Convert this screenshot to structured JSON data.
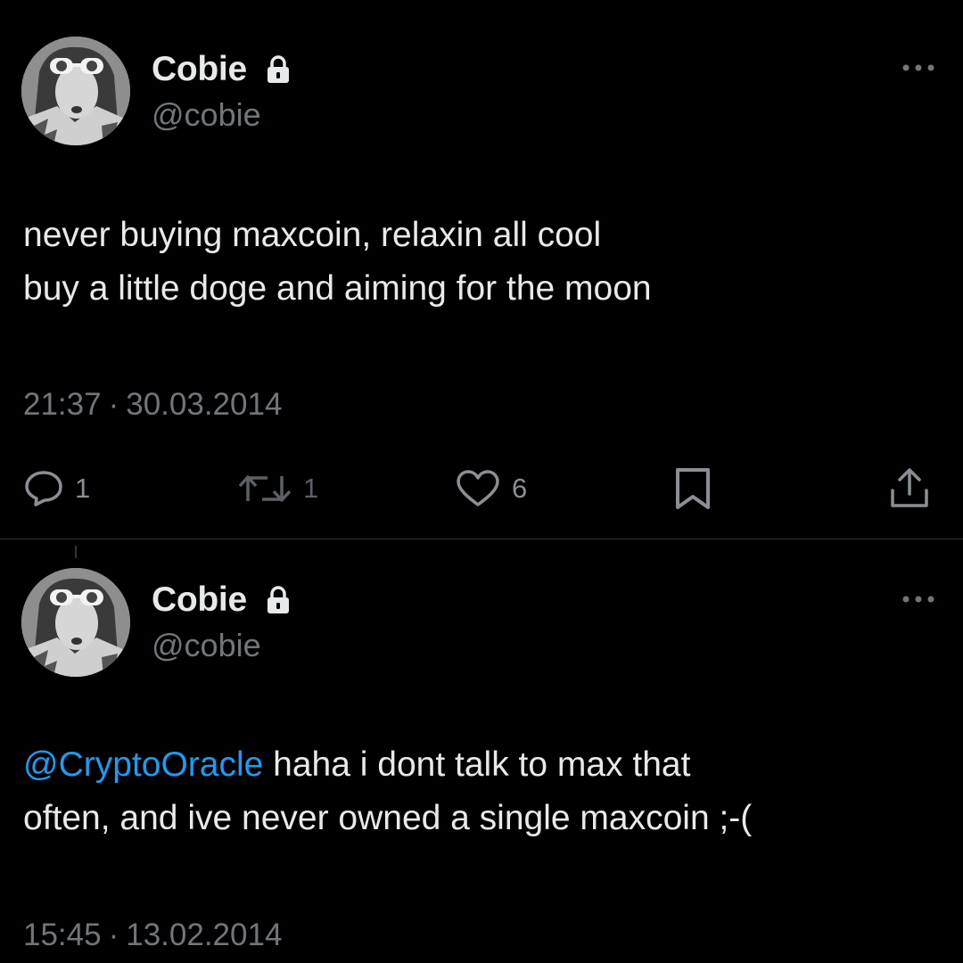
{
  "colors": {
    "background": "#000000",
    "text": "#e7e9ea",
    "secondary": "#71767b",
    "mention": "#1d9bf0",
    "divider": "#2f3336"
  },
  "tweets": [
    {
      "author": {
        "name": "Cobie",
        "handle": "@cobie",
        "protected_icon": "lock-icon"
      },
      "text_lines": [
        "never buying maxcoin, relaxin all cool",
        "buy a little doge and aiming for the moon"
      ],
      "time": "21:37",
      "separator": "·",
      "date": "30.03.2014",
      "actions": {
        "reply": {
          "icon": "reply-icon",
          "count": "1"
        },
        "retweet": {
          "icon": "retweet-icon",
          "count": "1"
        },
        "like": {
          "icon": "heart-icon",
          "count": "6"
        },
        "bookmark": {
          "icon": "bookmark-icon"
        },
        "share": {
          "icon": "share-icon"
        }
      }
    },
    {
      "author": {
        "name": "Cobie",
        "handle": "@cobie",
        "protected_icon": "lock-icon"
      },
      "mention": "@CryptoOracle",
      "text_line_1_rest": " haha i dont talk to max that",
      "text_line_2": "often, and ive never owned a single maxcoin ;-(",
      "time": "15:45",
      "separator": "·",
      "date": "13.02.2014"
    }
  ]
}
